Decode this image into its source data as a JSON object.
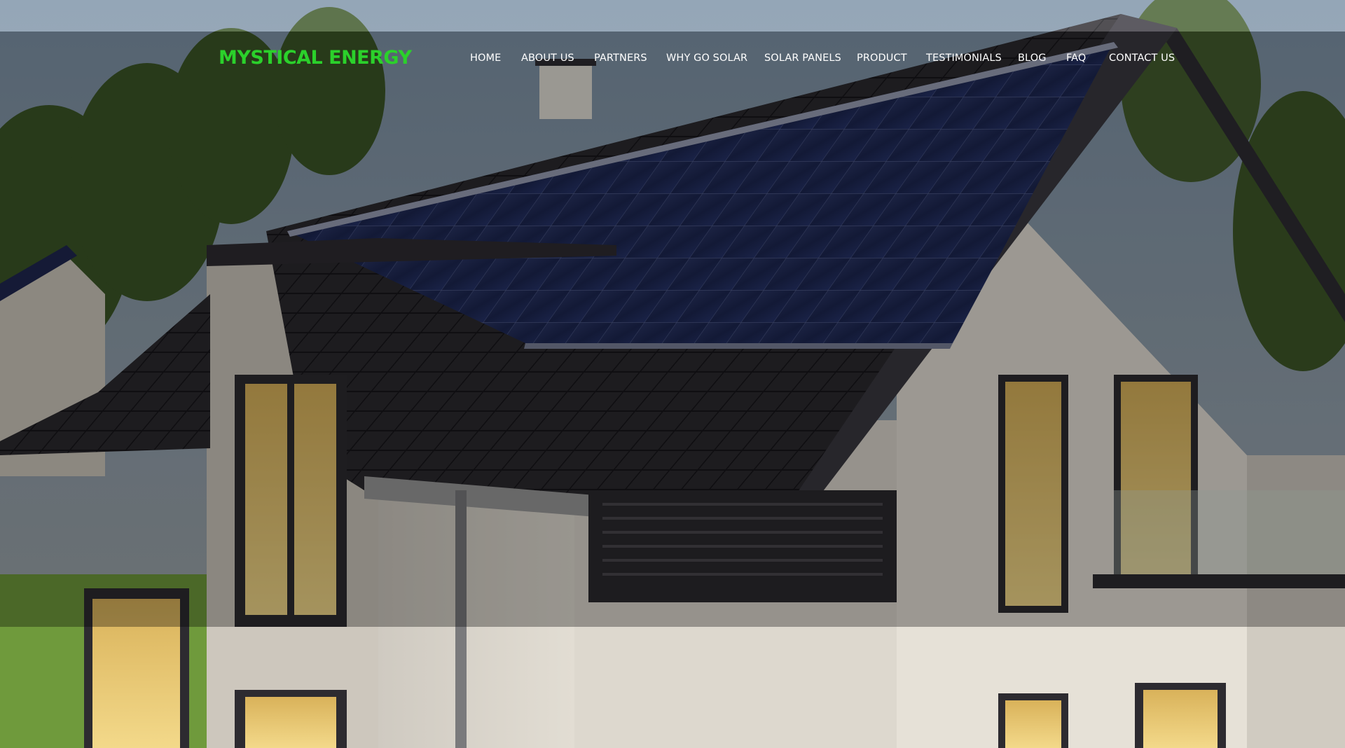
{
  "colors": {
    "brand": "#2bd12b",
    "nav_text": "#ffffff",
    "overlay": "rgba(0,0,0,0.32)",
    "sky": "#6e8598",
    "panel": "#1f2a52",
    "roof": "#2d2b30",
    "wall": "#d7d2c8",
    "window_glow": "#e8c46a",
    "grass": "#6f9a3c",
    "trees": "#3f5a2a"
  },
  "header": {
    "brand": "MYSTICAL ENERGY",
    "nav": [
      {
        "label": "HOME"
      },
      {
        "label": "ABOUT US"
      },
      {
        "label": "PARTNERS"
      },
      {
        "label": "WHY GO SOLAR"
      },
      {
        "label": "SOLAR PANELS"
      },
      {
        "label": "PRODUCT"
      },
      {
        "label": "TESTIMONIALS"
      },
      {
        "label": "BLOG"
      },
      {
        "label": "FAQ"
      },
      {
        "label": "CONTACT US"
      }
    ]
  },
  "hero": {
    "image_subject": "house-with-rooftop-solar-panels"
  }
}
